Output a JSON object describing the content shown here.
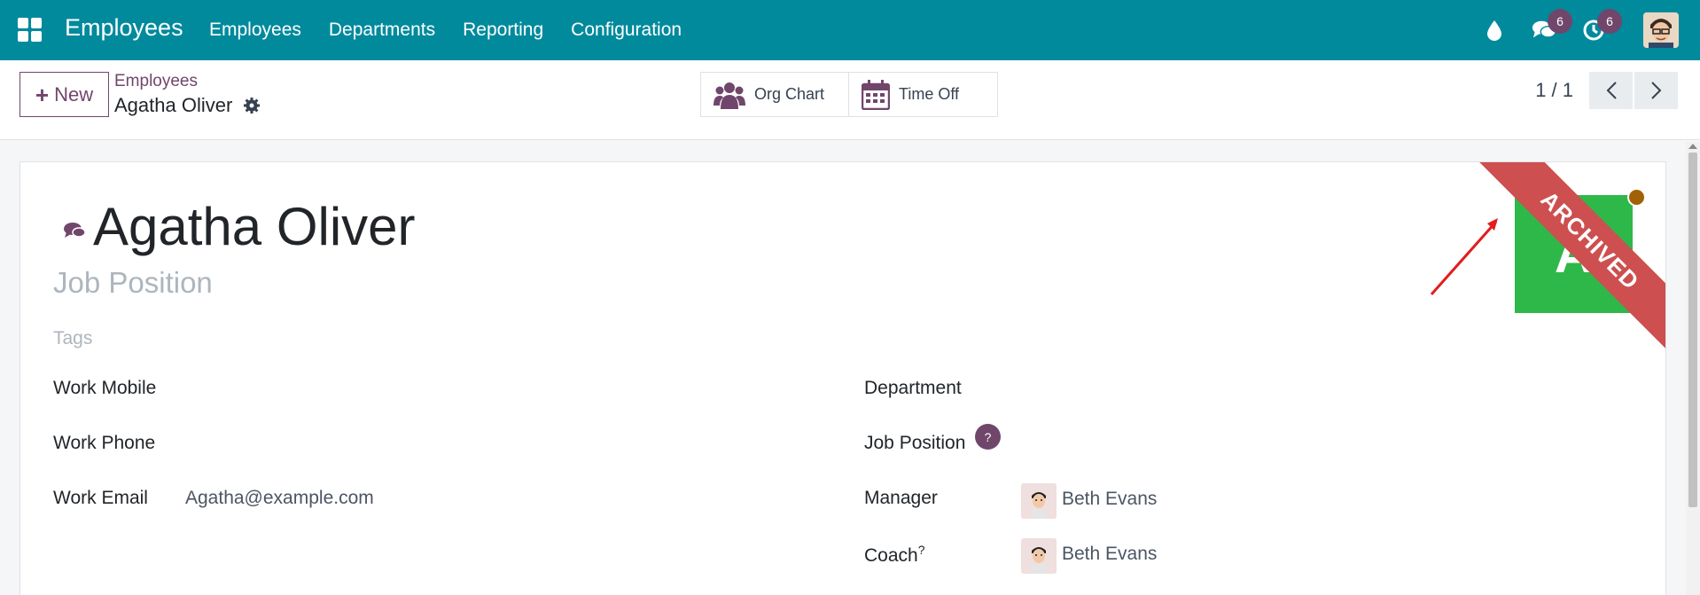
{
  "navbar": {
    "app_name": "Employees",
    "menu": [
      "Employees",
      "Departments",
      "Reporting",
      "Configuration"
    ],
    "messages_count": "6",
    "activities_count": "6",
    "icons": [
      "apps-grid-icon",
      "drop-icon",
      "chat-icon",
      "clock-icon",
      "user-avatar"
    ]
  },
  "control_panel": {
    "new_label": "New",
    "breadcrumb_parent": "Employees",
    "breadcrumb_current": "Agatha Oliver",
    "smart_buttons": {
      "org_chart": "Org Chart",
      "time_off": "Time Off"
    },
    "pager": "1 / 1"
  },
  "form": {
    "name": "Agatha Oliver",
    "job_title_placeholder": "Job Position",
    "tags_placeholder": "Tags",
    "ribbon": "ARCHIVED",
    "photo_initial": "A",
    "left_fields": {
      "work_mobile_label": "Work Mobile",
      "work_phone_label": "Work Phone",
      "work_email_label": "Work Email",
      "work_email_value": "Agatha@example.com"
    },
    "right_fields": {
      "department_label": "Department",
      "job_position_label": "Job Position",
      "job_position_help": "?",
      "manager_label": "Manager",
      "manager_value": "Beth Evans",
      "coach_label": "Coach",
      "coach_help": "?",
      "coach_value": "Beth Evans"
    }
  },
  "colors": {
    "navbar": "#018a9c",
    "primary": "#71466b",
    "ribbon": "#cd4f4f",
    "photo_bg": "#2eb849",
    "status": "#a16207"
  }
}
